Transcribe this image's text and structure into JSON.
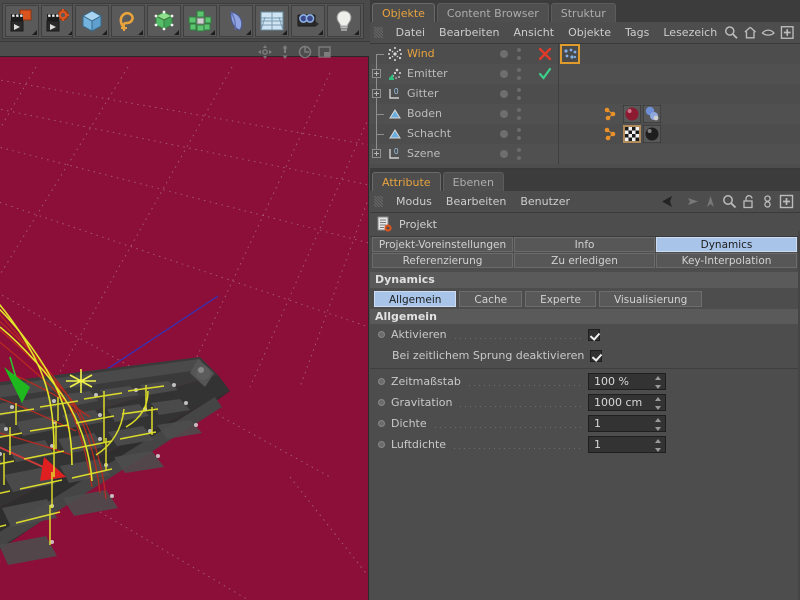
{
  "toolbar": {
    "groups": [
      {
        "name": "animation-group",
        "buttons": [
          {
            "name": "render-view-button",
            "icon": "clapperboard-orange-icon"
          },
          {
            "name": "render-settings-button",
            "icon": "clapperboard-gear-icon"
          }
        ]
      },
      {
        "name": "primitives-group",
        "buttons": [
          {
            "name": "cube-primitive-button",
            "icon": "blue-cube-icon"
          },
          {
            "name": "spline-button",
            "icon": "orange-spline-icon"
          },
          {
            "name": "hypernurbs-button",
            "icon": "green-subdivision-cube-icon"
          },
          {
            "name": "array-button",
            "icon": "green-cluster-icon"
          },
          {
            "name": "bend-deformer-button",
            "icon": "blue-bend-icon"
          },
          {
            "name": "floor-button",
            "icon": "grid-floor-icon"
          },
          {
            "name": "camera-button",
            "icon": "camera-icon"
          },
          {
            "name": "light-button",
            "icon": "lightbulb-icon"
          }
        ]
      }
    ]
  },
  "viewport": {
    "nav_icons": [
      "move-view-icon",
      "zoom-view-icon",
      "rotate-view-icon",
      "maximize-view-icon"
    ],
    "background_color": "#8b0f38",
    "grid_color": "#b0708c",
    "axis_z_color": "#2b37c8",
    "axis_x_color": "#d03a3a",
    "wind_line_color": "#e3e32a",
    "trail_color": "#bb2a20",
    "object_color": "#3a3a3a"
  },
  "object_manager": {
    "tabs": [
      {
        "label": "Objekte",
        "active": true
      },
      {
        "label": "Content Browser",
        "active": false
      },
      {
        "label": "Struktur",
        "active": false
      }
    ],
    "menu": [
      "Datei",
      "Bearbeiten",
      "Ansicht",
      "Objekte",
      "Tags",
      "Lesezeich"
    ],
    "menu_icons": [
      "search-icon",
      "home-icon",
      "eye-icon",
      "plus-box-icon"
    ],
    "rows": [
      {
        "label": "Wind",
        "icon": "wind-object-icon",
        "expandable": false,
        "selected": true,
        "mark": "red-x-icon",
        "tags": [
          "wind-tag"
        ]
      },
      {
        "label": "Emitter",
        "icon": "emitter-object-icon",
        "expandable": true,
        "selected": false,
        "mark": "green-check-icon",
        "tags": []
      },
      {
        "label": "Gitter",
        "icon": "null-object-icon",
        "expandable": true,
        "selected": false,
        "mark": "",
        "tags": []
      },
      {
        "label": "Boden",
        "icon": "floor-object-icon",
        "expandable": false,
        "selected": false,
        "mark": "",
        "tags": [
          "dynamics-tag",
          "red-material-tag",
          "blue-material-tag"
        ]
      },
      {
        "label": "Schacht",
        "icon": "floor-object-icon",
        "expandable": false,
        "selected": false,
        "mark": "",
        "tags": [
          "dynamics-tag",
          "checker-material-tag",
          "dark-material-tag"
        ]
      },
      {
        "label": "Szene",
        "icon": "null-object-icon",
        "expandable": true,
        "selected": false,
        "mark": "",
        "tags": []
      }
    ]
  },
  "attribute_manager": {
    "tabs": [
      {
        "label": "Attribute",
        "active": true
      },
      {
        "label": "Ebenen",
        "active": false
      }
    ],
    "menu": [
      "Modus",
      "Bearbeiten",
      "Benutzer"
    ],
    "nav_icons": [
      "back-arrow-icon",
      "forward-arrow-icon",
      "up-arrow-icon",
      "search-icon",
      "lock-icon",
      "link-icon",
      "plus-box-icon"
    ],
    "header": {
      "title": "Projekt",
      "icon": "project-settings-icon"
    },
    "mode_tabs": [
      {
        "label": "Projekt-Voreinstellungen",
        "active": false
      },
      {
        "label": "Info",
        "active": false
      },
      {
        "label": "Dynamics",
        "active": true
      },
      {
        "label": "Referenzierung",
        "active": false
      },
      {
        "label": "Zu erledigen",
        "active": false
      },
      {
        "label": "Key-Interpolation",
        "active": false
      }
    ],
    "section_title": "Dynamics",
    "sub_tabs": [
      {
        "label": "Allgemein",
        "active": true
      },
      {
        "label": "Cache",
        "active": false
      },
      {
        "label": "Experte",
        "active": false
      },
      {
        "label": "Visualisierung",
        "active": false
      }
    ],
    "group_title": "Allgemein",
    "checkboxes": [
      {
        "label": "Aktivieren",
        "checked": true,
        "has_bullet": true,
        "dotted": true
      },
      {
        "label": "Bei zeitlichem Sprung deaktivieren",
        "checked": true,
        "has_bullet": false,
        "dotted": false
      }
    ],
    "fields": [
      {
        "label": "Zeitmaßstab",
        "value": "100 %"
      },
      {
        "label": "Gravitation",
        "value": "1000 cm"
      },
      {
        "label": "Dichte",
        "value": "1"
      },
      {
        "label": "Luftdichte",
        "value": "1"
      }
    ]
  },
  "colors": {
    "panel_bg": "#4d4d4d",
    "accent_tab": "#e8a33d",
    "active_tab_bg": "#a8c4e8",
    "section_bg": "#5a5a5a",
    "field_bg": "#333333"
  }
}
